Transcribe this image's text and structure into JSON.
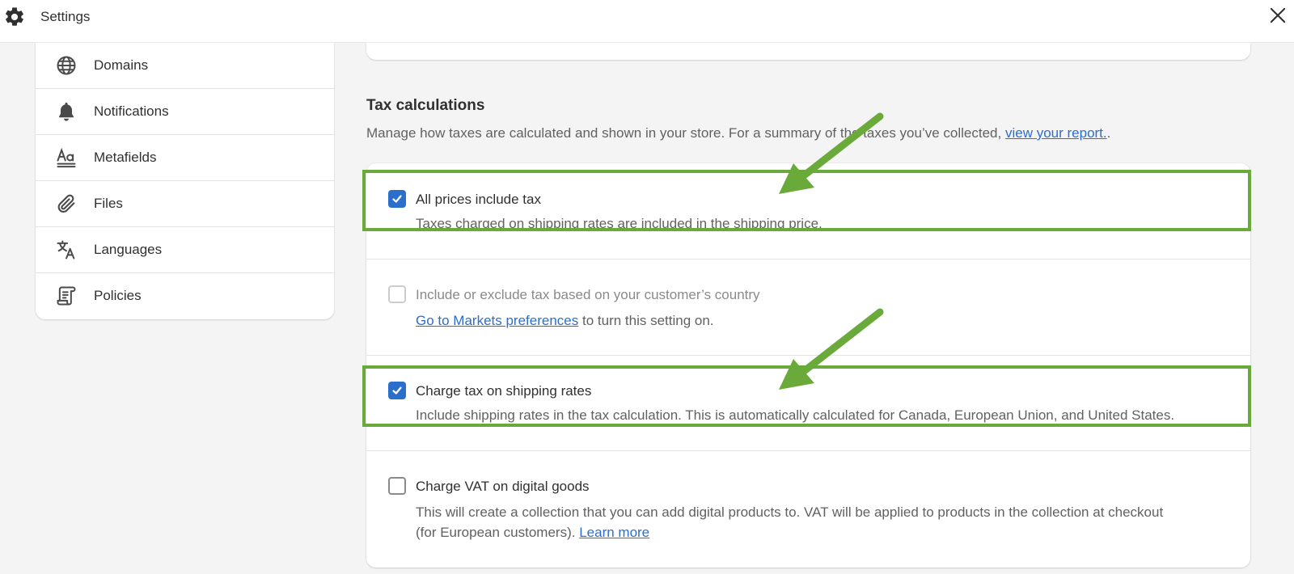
{
  "header": {
    "title": "Settings"
  },
  "sidebar": {
    "items": [
      {
        "label": "Domains",
        "icon": "globe-icon"
      },
      {
        "label": "Notifications",
        "icon": "bell-icon"
      },
      {
        "label": "Metafields",
        "icon": "metafields-icon"
      },
      {
        "label": "Files",
        "icon": "paperclip-icon"
      },
      {
        "label": "Languages",
        "icon": "translate-icon"
      },
      {
        "label": "Policies",
        "icon": "policy-scroll-icon"
      }
    ]
  },
  "tax": {
    "title": "Tax calculations",
    "desc_before": "Manage how taxes are calculated and shown in your store. For a summary of the taxes you’ve collected, ",
    "desc_link": "view your report.",
    "desc_after": ".",
    "options": [
      {
        "label": "All prices include tax",
        "help": "Taxes charged on shipping rates are included in the shipping price.",
        "checked": true,
        "disabled": false
      },
      {
        "label": "Include or exclude tax based on your customer’s country",
        "help_link": "Go to Markets preferences",
        "help_after": " to turn this setting on.",
        "checked": false,
        "disabled": true
      },
      {
        "label": "Charge tax on shipping rates",
        "help": "Include shipping rates in the tax calculation. This is automatically calculated for Canada, European Union, and United States.",
        "checked": true,
        "disabled": false
      },
      {
        "label": "Charge VAT on digital goods",
        "help_line1": "This will create a collection that you can add digital products to. VAT will be applied to products in the collection at checkout",
        "help_line2_before": "(for European customers). ",
        "help_link": "Learn more",
        "checked": false,
        "disabled": false
      }
    ]
  },
  "colors": {
    "accent": "#2c6ecb",
    "highlight": "#6aaa3a",
    "text": "#303030",
    "muted": "#616161"
  }
}
